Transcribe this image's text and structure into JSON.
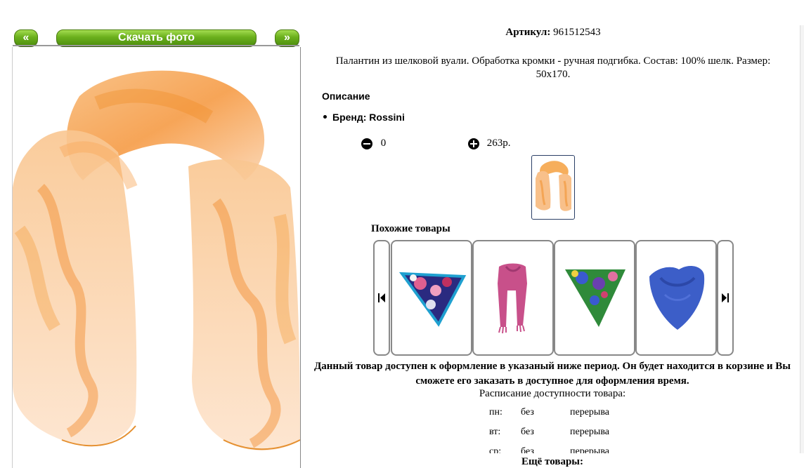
{
  "nav": {
    "prev_label": "«",
    "download_label": "Скачать фото",
    "next_label": "»"
  },
  "product": {
    "article_label": "Артикул:",
    "article_value": "961512543",
    "description": "Палантин из шелковой вуали. Обработка кромки - ручная подгибка. Состав: 100% шелк. Размер: 50x170.",
    "section_title": "Описание",
    "brand_line": "Бренд: Rossini",
    "quantity": "0",
    "price": "263р."
  },
  "similar": {
    "title": "Похожие товары"
  },
  "availability": {
    "notice": "Данный товар доступен к оформление в указаный ниже период. Он будет находится в корзине и Вы сможете его заказать в доступное для оформления время.",
    "schedule_title": "Расписание доступности товара:",
    "rows": [
      {
        "day": "пн:",
        "word": "без",
        "break": "перерыва"
      },
      {
        "day": "вт:",
        "word": "без",
        "break": "перерыва"
      },
      {
        "day": "ср:",
        "word": "без",
        "break": "перерыва"
      }
    ]
  },
  "more_title": "Ещё товары:",
  "colors": {
    "accent_green": "#6bb01d",
    "scarf_orange": "#f5a040"
  }
}
